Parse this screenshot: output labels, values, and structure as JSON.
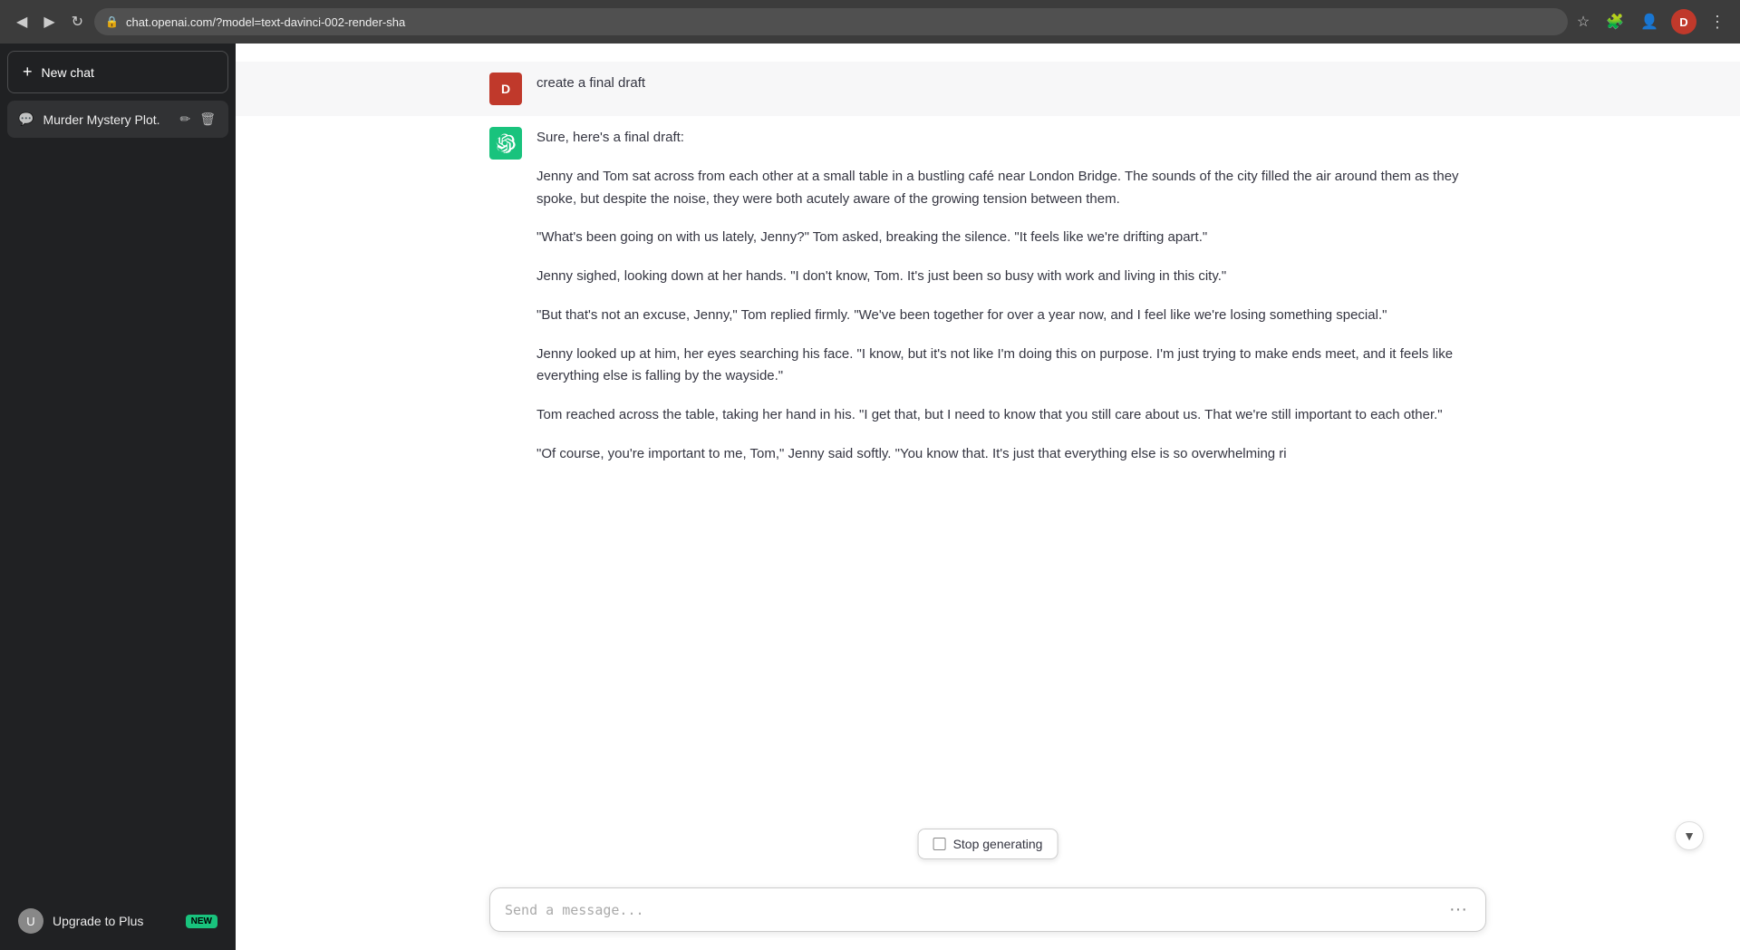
{
  "browser": {
    "url": "chat.openai.com/?model=text-davinci-002-render-sha",
    "back_icon": "◀",
    "forward_icon": "▶",
    "reload_icon": "↻",
    "lock_icon": "🔒",
    "user_initial": "D",
    "menu_icon": "⋮"
  },
  "sidebar": {
    "new_chat_label": "New chat",
    "new_chat_plus": "+",
    "chat_item_icon": "💬",
    "chat_item_label": "Murder Mystery Plot.",
    "edit_icon": "✏",
    "delete_icon": "🗑",
    "upgrade_label": "Upgrade to Plus",
    "upgrade_badge": "NEW",
    "user_initial": "U"
  },
  "chat": {
    "user_message": "create a final draft",
    "user_initial": "D",
    "ai_intro": "Sure, here's a final draft:",
    "paragraphs": [
      "Jenny and Tom sat across from each other at a small table in a bustling café near London Bridge. The sounds of the city filled the air around them as they spoke, but despite the noise, they were both acutely aware of the growing tension between them.",
      "\"What's been going on with us lately, Jenny?\" Tom asked, breaking the silence. \"It feels like we're drifting apart.\"",
      "Jenny sighed, looking down at her hands. \"I don't know, Tom. It's just been so busy with work and living in this city.\"",
      "\"But that's not an excuse, Jenny,\" Tom replied firmly. \"We've been together for over a year now, and I feel like we're losing something special.\"",
      "Jenny looked up at him, her eyes searching his face. \"I know, but it's not like I'm doing this on purpose. I'm just trying to make ends meet, and it feels like everything else is falling by the wayside.\"",
      "Tom reached across the table, taking her hand in his. \"I get that, but I need to know that you still care about us. That we're still important to each other.\"",
      "\"Of course, you're important to me, Tom,\" Jenny said softly. \"You know that. It's just that everything else is so overwhelming ri"
    ]
  },
  "input": {
    "placeholder": "Send a message...",
    "more_icon": "···"
  },
  "stop_button": {
    "label": "Stop generating"
  },
  "colors": {
    "sidebar_bg": "#202123",
    "ai_avatar_bg": "#19c37d",
    "user_avatar_bg": "#c0392b",
    "text_primary": "#343541"
  }
}
